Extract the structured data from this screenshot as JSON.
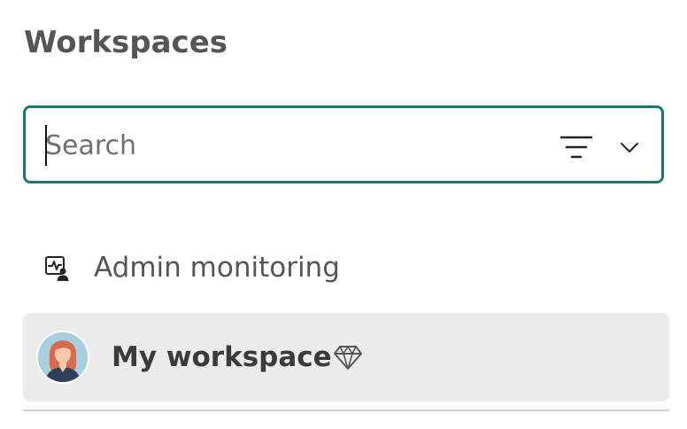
{
  "header": {
    "title": "Workspaces"
  },
  "search": {
    "placeholder": "Search",
    "value": ""
  },
  "icons": {
    "filter": "filter-icon",
    "chevron": "chevron-down-icon",
    "admin": "monitoring-icon",
    "premium": "diamond-icon"
  },
  "colors": {
    "search_border": "#1a7a66",
    "selected_bg": "#ebebeb"
  },
  "list": {
    "items": [
      {
        "label": "Admin monitoring",
        "selected": false
      },
      {
        "label": "My workspace",
        "selected": true
      }
    ]
  }
}
